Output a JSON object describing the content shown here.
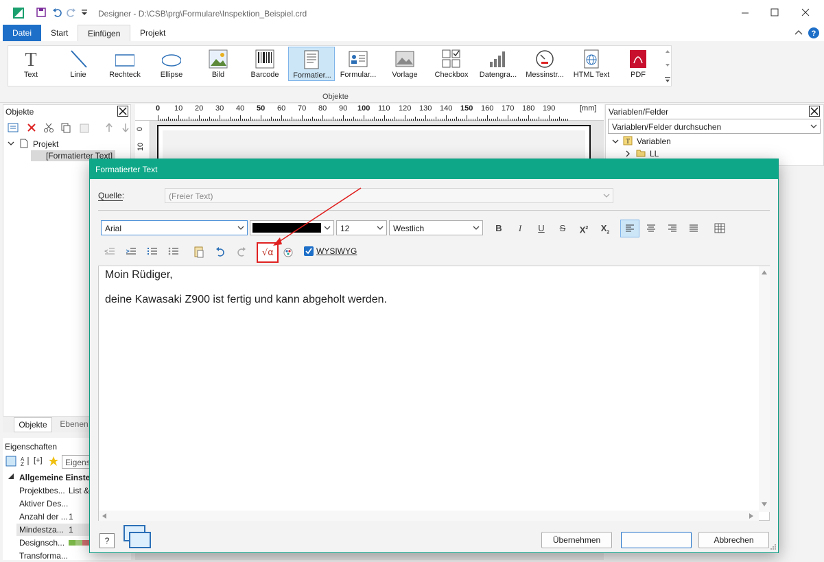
{
  "window": {
    "title": "Designer - D:\\CSB\\prg\\Formulare\\Inspektion_Beispiel.crd"
  },
  "tabs": [
    {
      "label": "Datei"
    },
    {
      "label": "Start"
    },
    {
      "label": "Einfügen"
    },
    {
      "label": "Projekt"
    }
  ],
  "ribbon": {
    "group_label": "Objekte",
    "items": [
      {
        "label": "Text",
        "icon": "text-icon"
      },
      {
        "label": "Linie",
        "icon": "line-icon"
      },
      {
        "label": "Rechteck",
        "icon": "rectangle-icon"
      },
      {
        "label": "Ellipse",
        "icon": "ellipse-icon"
      },
      {
        "label": "Bild",
        "icon": "image-icon"
      },
      {
        "label": "Barcode",
        "icon": "barcode-icon"
      },
      {
        "label": "Formatier...",
        "icon": "formatted-text-icon",
        "selected": true
      },
      {
        "label": "Formular...",
        "icon": "form-icon"
      },
      {
        "label": "Vorlage",
        "icon": "template-icon"
      },
      {
        "label": "Checkbox",
        "icon": "checkbox-icon"
      },
      {
        "label": "Datengra...",
        "icon": "chart-icon"
      },
      {
        "label": "Messinstr...",
        "icon": "gauge-icon"
      },
      {
        "label": "HTML Text",
        "icon": "html-icon"
      },
      {
        "label": "PDF",
        "icon": "pdf-icon"
      }
    ]
  },
  "objects_panel": {
    "title": "Objekte",
    "tree": {
      "root": "Projekt",
      "child": "[Formatierter Text]"
    },
    "bottom_tabs": [
      "Objekte",
      "Ebenen"
    ]
  },
  "properties_panel": {
    "title": "Eigenschaften",
    "search_placeholder": "Eigens",
    "add_label": "[+]",
    "group": "Allgemeine Einstel",
    "rows": [
      {
        "name": "Projektbes...",
        "value": "List &"
      },
      {
        "name": "Aktiver Des...",
        "value": ""
      },
      {
        "name": "Anzahl der ...",
        "value": "1"
      },
      {
        "name": "Mindestza...",
        "value": "1"
      },
      {
        "name": "Designsch...",
        "value": ""
      },
      {
        "name": "Transforma...",
        "value": ""
      }
    ]
  },
  "ruler": {
    "ticks": [
      "0",
      "10",
      "20",
      "30",
      "40",
      "50",
      "60",
      "70",
      "80",
      "90",
      "100",
      "110",
      "120",
      "130",
      "140",
      "150",
      "160",
      "170",
      "180",
      "190"
    ],
    "unit": "[mm]",
    "vertical": [
      "0",
      "10"
    ]
  },
  "variables_panel": {
    "title": "Variablen/Felder",
    "search_placeholder": "Variablen/Felder durchsuchen",
    "tree": {
      "root": "Variablen",
      "child": "LL"
    }
  },
  "dialog": {
    "title": "Formatierter Text",
    "source_label": "Quelle:",
    "source_value": "(Freier Text)",
    "font": "Arial",
    "color": "#000000",
    "size": "12",
    "script": "Westlich",
    "wysiwyg_label": "WYSIWYG",
    "wysiwyg_checked": true,
    "formula_glyph": "√α",
    "content": {
      "line1": "Moin Rüdiger,",
      "line2": "deine Kawasaki Z900 ist fertig und kann abgeholt werden."
    },
    "buttons": {
      "apply": "Übernehmen",
      "ok": "",
      "cancel": "Abbrechen"
    },
    "help_glyph": "?"
  },
  "annotation": {
    "color": "#e02020"
  }
}
